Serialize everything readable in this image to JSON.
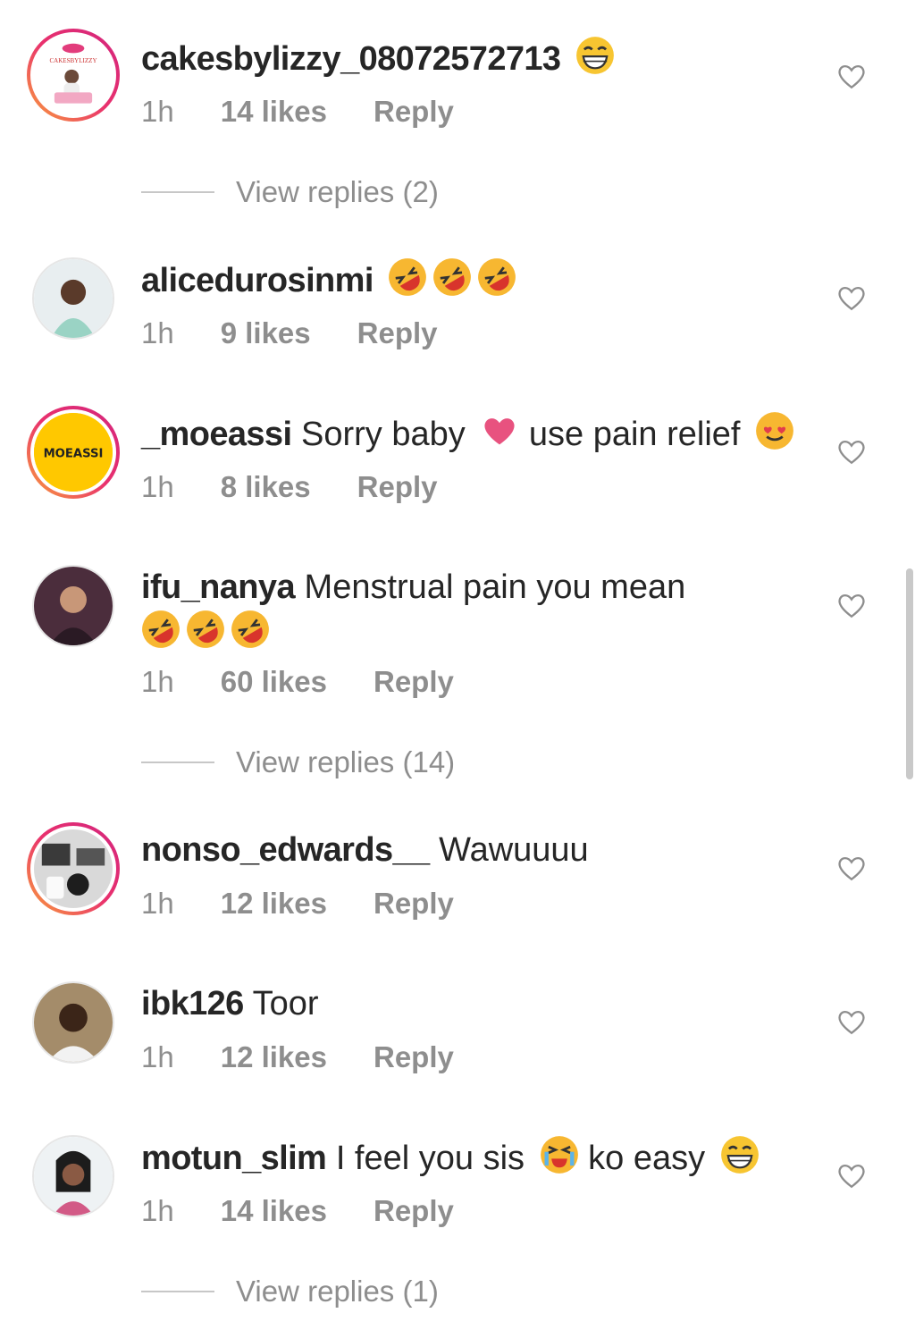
{
  "comments": [
    {
      "username": "cakesbylizzy_08072572713",
      "text": "",
      "emojis": [
        "grin"
      ],
      "time": "1h",
      "likes": "14 likes",
      "reply": "Reply",
      "view_replies": "View replies (2)",
      "avatar_label": "CAKESBYLIZZY"
    },
    {
      "username": "alicedurosinmi",
      "text": "",
      "emojis": [
        "rofl",
        "rofl",
        "rofl"
      ],
      "time": "1h",
      "likes": "9 likes",
      "reply": "Reply"
    },
    {
      "username": "_moeassi",
      "text": "Sorry baby",
      "text2": "use pain relief",
      "emojis": [
        "heart",
        "heart-eyes"
      ],
      "time": "1h",
      "likes": "8 likes",
      "reply": "Reply",
      "avatar_label": "MOEASSI"
    },
    {
      "username": "ifu_nanya",
      "text": "Menstrual pain you mean",
      "emojis": [
        "rofl",
        "rofl",
        "rofl"
      ],
      "time": "1h",
      "likes": "60 likes",
      "reply": "Reply",
      "view_replies": "View replies (14)"
    },
    {
      "username": "nonso_edwards__",
      "text": "Wawuuuu",
      "time": "1h",
      "likes": "12 likes",
      "reply": "Reply"
    },
    {
      "username": "ibk126",
      "text": "Toor",
      "time": "1h",
      "likes": "12 likes",
      "reply": "Reply"
    },
    {
      "username": "motun_slim",
      "text": "I feel you sis",
      "text2": "ko easy",
      "emojis": [
        "crying",
        "grin"
      ],
      "time": "1h",
      "likes": "14 likes",
      "reply": "Reply",
      "view_replies": "View replies (1)"
    }
  ],
  "icons": {
    "like": "heart-outline-icon"
  },
  "colors": {
    "text": "#262626",
    "muted": "#8e8e8e",
    "story_ring": "#e9316d",
    "emoji": "#f7c531"
  }
}
